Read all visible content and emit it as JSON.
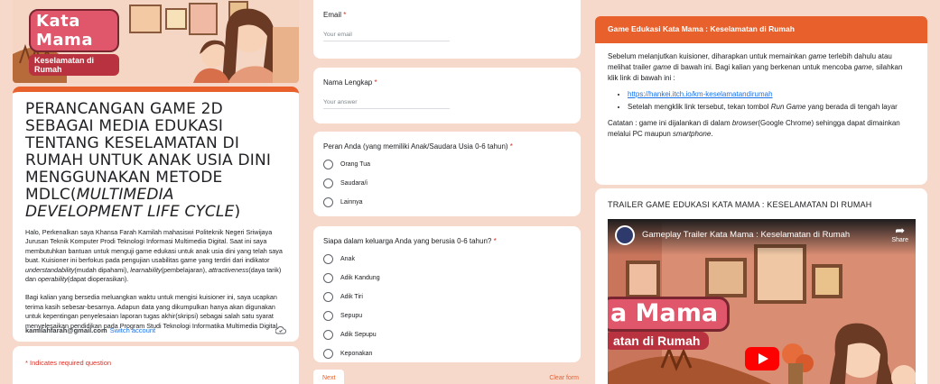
{
  "banner": {
    "logo_title": "Kata Mama",
    "logo_subtitle": "Keselamatan di Rumah"
  },
  "form": {
    "title_plain": "PERANCANGAN GAME 2D SEBAGAI MEDIA EDUKASI TENTANG KESELAMATAN DI RUMAH UNTUK ANAK USIA DINI MENGGUNAKAN METODE MDLC(",
    "title_italic": "MULTIMEDIA DEVELOPMENT LIFE CYCLE",
    "title_end": ")",
    "desc_p1_a": "Halo, Perkenalkan saya Khansa Farah Kamilah mahasiswi Politeknik Negeri Sriwijaya Jurusan Teknik Komputer Prodi Teknologi Informasi Multimedia Digital. Saat ini saya membutuhkan bantuan untuk menguji game edukasi untuk anak usia dini yang telah saya buat. Kuisioner ini berfokus pada pengujian usabilitas game yang terdiri dari indikator ",
    "desc_p1_i1": "understandability",
    "desc_p1_b": "(mudah dipahami), ",
    "desc_p1_i2": "learnability",
    "desc_p1_c": "(pembelajaran), ",
    "desc_p1_i3": "attractiveness",
    "desc_p1_d": "(daya tarik) dan ",
    "desc_p1_i4": "operability",
    "desc_p1_e": "(dapat dioperasikan).",
    "desc_p2": "Bagi kalian yang bersedia meluangkan waktu untuk mengisi kuisioner ini, saya ucapkan terima kasih sebesar-besarnya. Adapun data yang dikumpulkan hanya akan digunakan untuk kepentingan penyelesaian laporan tugas akhir(skripsi) sebagai salah satu syarat menyelesaikan pendidikan pada Program Studi Teknologi Informatika Multimedia Digital.",
    "account_email": "kamilahfarah@gmail.com",
    "switch_account": "Switch account",
    "required_note": "* Indicates required question"
  },
  "questions": {
    "email": {
      "label": "Email",
      "star": "*",
      "placeholder": "Your email"
    },
    "name": {
      "label": "Nama Lengkap",
      "star": "*",
      "placeholder": "Your answer"
    },
    "role": {
      "label": "Peran Anda (yang memiliki Anak/Saudara Usia 0-6 tahun)",
      "star": "*",
      "options": [
        "Orang Tua",
        "Saudara/i",
        "Lainnya"
      ]
    },
    "family": {
      "label": "Siapa dalam keluarga Anda yang berusia 0-6 tahun?",
      "star": "*",
      "options": [
        "Anak",
        "Adik Kandung",
        "Adik Tiri",
        "Sepupu",
        "Adik Sepupu",
        "Keponakan"
      ]
    },
    "next_label": "Next",
    "clear_label": "Clear form"
  },
  "section": {
    "header": "Game Edukasi Kata Mama : Keselamatan di Rumah",
    "intro_a": "Sebelum melanjutkan kuisioner, diharapkan untuk memainkan ",
    "intro_i1": "game",
    "intro_b": " terlebih dahulu atau melihat trailer ",
    "intro_i2": "game",
    "intro_c": " di bawah ini. Bagi kalian yang berkenan untuk mencoba ",
    "intro_i3": "game",
    "intro_d": ", silahkan klik link di bawah ini :",
    "link": "https://hankei.itch.io/km-keselamatandirumah",
    "bullet2_a": "Setelah mengklik link tersebut, tekan tombol ",
    "bullet2_i": "Run Game",
    "bullet2_b": " yang berada di tengah layar",
    "note_a": "Catatan : game ini dijalankan di dalam ",
    "note_i1": "browser",
    "note_b": "(Google Chrome) sehingga dapat dimainkan melalui PC maupun ",
    "note_i2": "smartphone",
    "note_c": "."
  },
  "trailer": {
    "title": "TRAILER GAME EDUKASI KATA MAMA : KESELAMATAN DI RUMAH",
    "video_title": "Gameplay Trailer Kata Mama : Keselamatan di Rumah",
    "share_label": "Share",
    "overlay_logo": "a Mama",
    "overlay_sub": "atan di Rumah"
  },
  "colors": {
    "accent": "#e8602c",
    "background": "#f7d9cb",
    "link": "#1a73e8",
    "required": "#d93025"
  }
}
